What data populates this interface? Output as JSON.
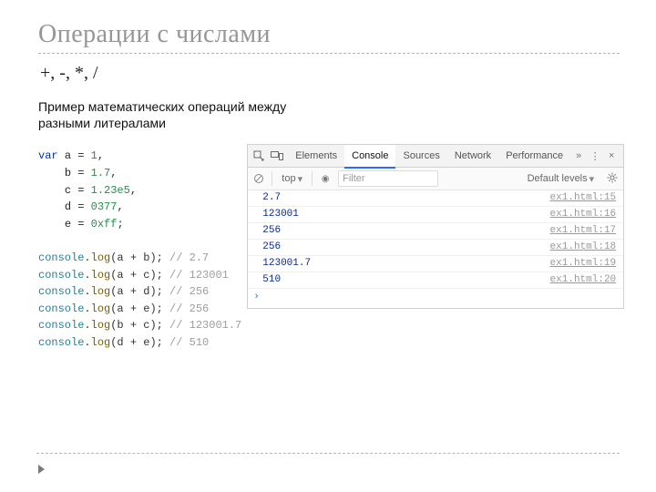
{
  "title": "Операции с числами",
  "operators": "+, -, *, /",
  "subtitle": "Пример математических операций между разными литералами",
  "code": {
    "var": "var",
    "a": "a = ",
    "av": "1",
    "b": "b = ",
    "bv": "1.7",
    "c": "c = ",
    "cv": "1.23e5",
    "d": "d = ",
    "dv": "0377",
    "e": "e = ",
    "ev": "0xff",
    "cons": "console",
    "log": "log",
    "l1": "(a + b);",
    "c1": "// 2.7",
    "l2": "(a + c);",
    "c2": "// 123001",
    "l3": "(a + d);",
    "c3": "// 256",
    "l4": "(a + e);",
    "c4": "// 256",
    "l5": "(b + c);",
    "c5": "// 123001.7",
    "l6": "(d + e);",
    "c6": "// 510"
  },
  "devtools": {
    "tabs": {
      "elements": "Elements",
      "console": "Console",
      "sources": "Sources",
      "network": "Network",
      "performance": "Performance"
    },
    "chevrons": "»",
    "dots": "⋮",
    "close": "×",
    "toolbar": {
      "context": "top",
      "eye": "◉",
      "filter_placeholder": "Filter",
      "levels": "Default levels"
    },
    "lines": [
      {
        "val": "2.7",
        "src": "ex1.html:15"
      },
      {
        "val": "123001",
        "src": "ex1.html:16"
      },
      {
        "val": "256",
        "src": "ex1.html:17"
      },
      {
        "val": "256",
        "src": "ex1.html:18"
      },
      {
        "val": "123001.7",
        "src": "ex1.html:19"
      },
      {
        "val": "510",
        "src": "ex1.html:20"
      }
    ],
    "prompt": "›"
  }
}
